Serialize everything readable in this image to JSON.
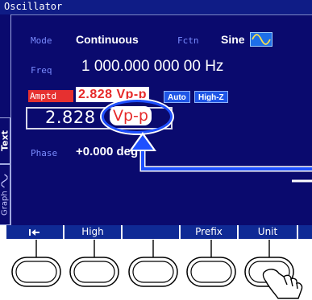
{
  "window": {
    "title": "Oscillator"
  },
  "side_tabs": {
    "text_label": "Text",
    "graph_label": "Graph"
  },
  "params": {
    "mode_label": "Mode",
    "mode_value": "Continuous",
    "fctn_label": "Fctn",
    "fctn_value": "Sine",
    "fctn_icon": "sine-wave-icon",
    "freq_label": "Freq",
    "freq_value": "1 000.000 000 00 Hz",
    "amptd_label": "Amptd",
    "amptd_value": "2.828 Vp-p",
    "auto_badge": "Auto",
    "highz_badge": "High-Z",
    "phase_label": "Phase",
    "phase_value": "+0.000 deg"
  },
  "entry": {
    "number": "2.828",
    "unit": "Vp-p"
  },
  "softkeys": [
    {
      "label": "",
      "icon": "back-arrow-icon"
    },
    {
      "label": "High"
    },
    {
      "label": ""
    },
    {
      "label": "Prefix"
    },
    {
      "label": "Unit"
    }
  ],
  "colors": {
    "screen_bg": "#0a0a6e",
    "label_blue": "#7a8cff",
    "amptd_red": "#e63030",
    "highlight_ring": "#1e50ff"
  }
}
